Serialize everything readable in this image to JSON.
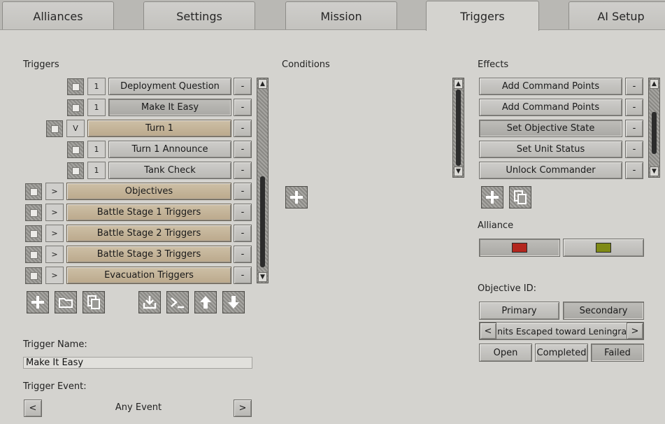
{
  "tabs": [
    "Alliances",
    "Settings",
    "Mission",
    "Triggers",
    "AI Setup"
  ],
  "triggers_panel": {
    "heading": "Triggers",
    "rows": [
      {
        "indent": 2,
        "toggle": "1",
        "label": "Deployment Question",
        "style": "normal",
        "remove": "-"
      },
      {
        "indent": 2,
        "toggle": "1",
        "label": "Make It Easy",
        "style": "selected",
        "remove": "-"
      },
      {
        "indent": 1,
        "toggle": "V",
        "label": "Turn 1",
        "style": "tan",
        "remove": "-"
      },
      {
        "indent": 2,
        "toggle": "1",
        "label": "Turn 1 Announce",
        "style": "normal",
        "remove": "-"
      },
      {
        "indent": 2,
        "toggle": "1",
        "label": "Tank Check",
        "style": "normal",
        "remove": "-"
      },
      {
        "indent": 0,
        "toggle": ">",
        "label": "Objectives",
        "style": "tan",
        "remove": "-"
      },
      {
        "indent": 0,
        "toggle": ">",
        "label": "Battle Stage 1 Triggers",
        "style": "tan",
        "remove": "-"
      },
      {
        "indent": 0,
        "toggle": ">",
        "label": "Battle Stage 2 Triggers",
        "style": "tan",
        "remove": "-"
      },
      {
        "indent": 0,
        "toggle": ">",
        "label": "Battle Stage 3 Triggers",
        "style": "tan",
        "remove": "-"
      },
      {
        "indent": 0,
        "toggle": ">",
        "label": "Evacuation Triggers",
        "style": "tan",
        "remove": "-"
      }
    ],
    "toolbar_icons": [
      "add-icon",
      "folder-icon",
      "copy-icon",
      "import-icon",
      "console-icon",
      "move-up-icon",
      "move-down-icon"
    ]
  },
  "trigger_name": {
    "label": "Trigger Name:",
    "value": "Make It Easy"
  },
  "trigger_event": {
    "label": "Trigger Event:",
    "prev": "<",
    "value": "Any Event",
    "next": ">"
  },
  "conditions": {
    "heading": "Conditions"
  },
  "effects": {
    "heading": "Effects",
    "rows": [
      {
        "label": "Add Command Points",
        "remove": "-",
        "selected": false
      },
      {
        "label": "Add Command Points",
        "remove": "-",
        "selected": false
      },
      {
        "label": "Set Objective State",
        "remove": "-",
        "selected": true
      },
      {
        "label": "Set Unit Status",
        "remove": "-",
        "selected": false
      },
      {
        "label": "Unlock Commander",
        "remove": "-",
        "selected": false
      }
    ]
  },
  "alliance": {
    "heading": "Alliance",
    "options": [
      {
        "color": "#b3261e",
        "selected": true
      },
      {
        "color": "#7f8a15",
        "selected": false
      }
    ]
  },
  "objective_id": {
    "heading": "Objective ID:",
    "types": [
      {
        "label": "Primary",
        "selected": false
      },
      {
        "label": "Secondary",
        "selected": true
      }
    ],
    "prev": "<",
    "name": "Units Escaped toward Leningrad",
    "next": ">",
    "states": [
      {
        "label": "Open",
        "selected": false
      },
      {
        "label": "Completed",
        "selected": false
      },
      {
        "label": "Failed",
        "selected": true
      }
    ]
  }
}
